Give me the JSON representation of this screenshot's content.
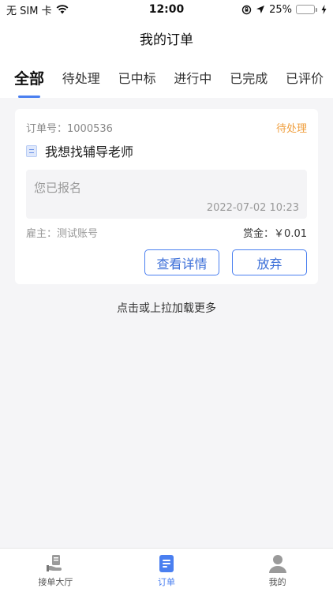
{
  "status_bar": {
    "carrier": "无 SIM 卡",
    "time": "12:00",
    "battery": "25%",
    "battery_level": 0.25
  },
  "nav": {
    "title": "我的订单"
  },
  "tabs": [
    {
      "label": "全部",
      "active": true
    },
    {
      "label": "待处理",
      "active": false
    },
    {
      "label": "已中标",
      "active": false
    },
    {
      "label": "进行中",
      "active": false
    },
    {
      "label": "已完成",
      "active": false
    },
    {
      "label": "已评价",
      "active": false
    }
  ],
  "order": {
    "number": "订单号：1000536",
    "status": "待处理",
    "title": "我想找辅导老师",
    "note": "您已报名",
    "time": "2022-07-02 10:23",
    "employer": "雇主：测试账号",
    "reward": "赏金：￥0.01",
    "view_details_label": "查看详情",
    "abandon_label": "放弃"
  },
  "load_more": "点击或上拉加载更多",
  "tabbar": {
    "items": [
      {
        "label": "接单大厅",
        "icon": "hand-document-icon"
      },
      {
        "label": "订单",
        "icon": "order-list-icon"
      },
      {
        "label": "我的",
        "icon": "person-icon"
      }
    ]
  },
  "colors": {
    "accent": "#4a7ff0",
    "pending": "#f0a040",
    "background": "#f5f5f7"
  }
}
